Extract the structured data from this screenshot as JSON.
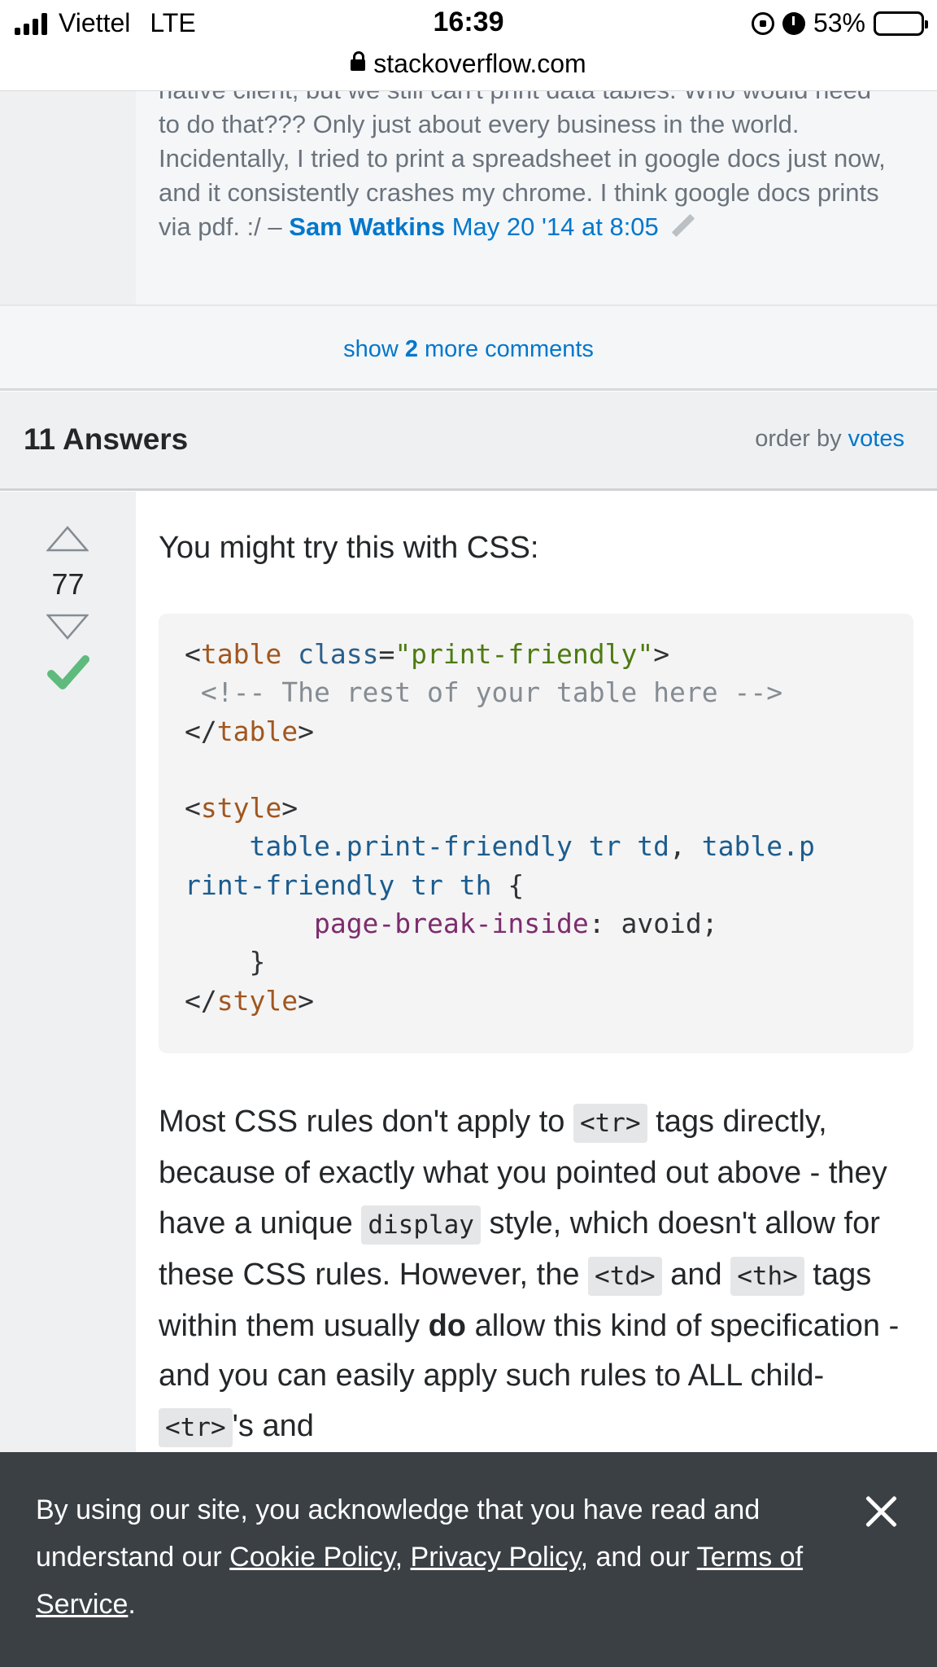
{
  "status_bar": {
    "carrier": "Viettel",
    "network": "LTE",
    "time": "16:39",
    "battery_pct": "53%",
    "battery_level": 0.53
  },
  "browser": {
    "url": "stackoverflow.com"
  },
  "comment": {
    "text": "native client, but we still can't print data tables. Who would need to do that??? Only just about every business in the world. Incidentally, I tried to print a spreadsheet in google docs just now, and it consistently crashes my chrome. I think google docs prints via pdf. :/ – ",
    "author": "Sam Watkins",
    "date": "May 20 '14 at 8:05"
  },
  "show_more": {
    "prefix": "show ",
    "count": "2",
    "suffix": " more comments"
  },
  "answers_header": {
    "title": "11 Answers",
    "order_label": "order by ",
    "order_value": "votes"
  },
  "answer": {
    "votes": "77",
    "intro": "You might try this with CSS:",
    "code": {
      "l1_open": "<",
      "l1_tag": "table",
      "l1_attr": "class",
      "l1_eq": "=",
      "l1_str": "\"print-friendly\"",
      "l1_close": ">",
      "l2_comment": " <!-- The rest of your table here -->",
      "l3_open": "</",
      "l3_tag": "table",
      "l3_close": ">",
      "l5_open": "<",
      "l5_tag": "style",
      "l5_close": ">",
      "l6_indent": "    ",
      "l6_sel1": "table.print-friendly tr td",
      "l6_comma": ", ",
      "l6_sel2a": "table.p",
      "l7_sel2b": "rint-friendly tr th",
      "l7_brace": " {",
      "l8_indent": "        ",
      "l8_prop": "page-break-inside",
      "l8_value": ": avoid;",
      "l9_brace": "    }",
      "l10_open": "</",
      "l10_tag": "style",
      "l10_close": ">"
    },
    "p1": "Most CSS rules don't apply to ",
    "code_tr": "<tr>",
    "p2": " tags directly, because of exactly what you pointed out above - they have a unique ",
    "code_display": "display",
    "p3": " style, which doesn't allow for these CSS rules. However, the ",
    "code_td": "<td>",
    "p4": " and ",
    "code_th": "<th>",
    "p5": " tags within them usually ",
    "p5_bold": "do",
    "p6": " allow this kind of specification - and you can easily apply such rules to ALL child-",
    "code_tr2": "<tr>",
    "p7": "'s and"
  },
  "cookie_banner": {
    "t1": "By using our site, you acknowledge that you have read and understand our ",
    "cookie_policy": "Cookie Policy",
    "t2": ", ",
    "privacy_policy": "Privacy Policy",
    "t3": ", and our ",
    "terms": "Terms of Service",
    "t4": "."
  },
  "colors": {
    "link": "#0077cc",
    "accepted": "#5eba7d",
    "banner": "#3b4045"
  }
}
